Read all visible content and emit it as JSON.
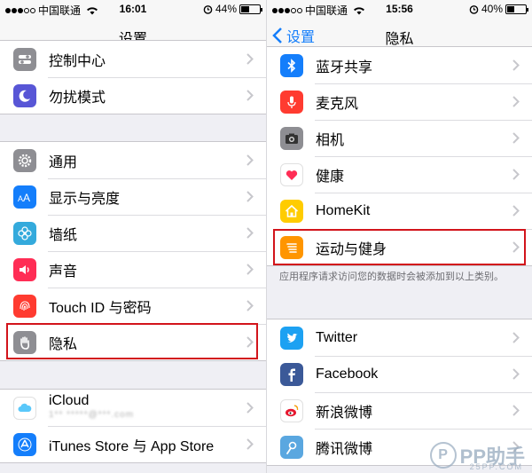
{
  "left": {
    "status": {
      "carrier": "中国联通",
      "time": "16:01",
      "battery": "44%",
      "battery_level": 0.44
    },
    "nav_title": "设置",
    "rows_top": [
      {
        "label": "控制中心",
        "icon": "control-center-icon",
        "color": "#8e8e93"
      },
      {
        "label": "勿扰模式",
        "icon": "moon-icon",
        "color": "#5856d6"
      }
    ],
    "rows_mid": [
      {
        "label": "通用",
        "icon": "gear-icon",
        "color": "#8e8e93"
      },
      {
        "label": "显示与亮度",
        "icon": "text-size-icon",
        "color": "#147efb"
      },
      {
        "label": "墙纸",
        "icon": "flower-icon",
        "color": "#34aadc"
      },
      {
        "label": "声音",
        "icon": "speaker-icon",
        "color": "#ff2d55"
      },
      {
        "label": "Touch ID 与密码",
        "icon": "fingerprint-icon",
        "color": "#ff3b30"
      },
      {
        "label": "隐私",
        "icon": "hand-icon",
        "color": "#8e8e93"
      }
    ],
    "rows_bottom": [
      {
        "label": "iCloud",
        "sub": "1**  *****@***.com",
        "icon": "cloud-icon",
        "color": "#ffffff"
      },
      {
        "label": "iTunes Store 与 App Store",
        "icon": "app-store-icon",
        "color": "#147efb"
      }
    ]
  },
  "right": {
    "status": {
      "carrier": "中国联通",
      "time": "15:56",
      "battery": "40%",
      "battery_level": 0.4
    },
    "nav_title": "隐私",
    "back_label": "设置",
    "rows_top": [
      {
        "label": "蓝牙共享",
        "icon": "bluetooth-icon",
        "color": "#147efb"
      },
      {
        "label": "麦克风",
        "icon": "microphone-icon",
        "color": "#ff3b30"
      },
      {
        "label": "相机",
        "icon": "camera-icon",
        "color": "#8e8e93"
      },
      {
        "label": "健康",
        "icon": "heart-icon",
        "color": "#ffffff"
      },
      {
        "label": "HomeKit",
        "icon": "home-icon",
        "color": "#ffcc00"
      },
      {
        "label": "运动与健身",
        "icon": "motion-icon",
        "color": "#ff9500"
      }
    ],
    "footnote": "应用程序请求访问您的数据时会被添加到以上类别。",
    "rows_bottom": [
      {
        "label": "Twitter",
        "icon": "twitter-icon",
        "color": "#1da1f2"
      },
      {
        "label": "Facebook",
        "icon": "facebook-icon",
        "color": "#3b5998"
      },
      {
        "label": "新浪微博",
        "icon": "weibo-icon",
        "color": "#ffffff"
      },
      {
        "label": "腾讯微博",
        "icon": "tencent-weibo-icon",
        "color": "#5aa7e0"
      }
    ]
  },
  "watermark": {
    "logo": "P",
    "brand": "PP助手",
    "domain": "25PP.COM"
  },
  "accent": "#147efb",
  "highlight_color": "#d2141b"
}
